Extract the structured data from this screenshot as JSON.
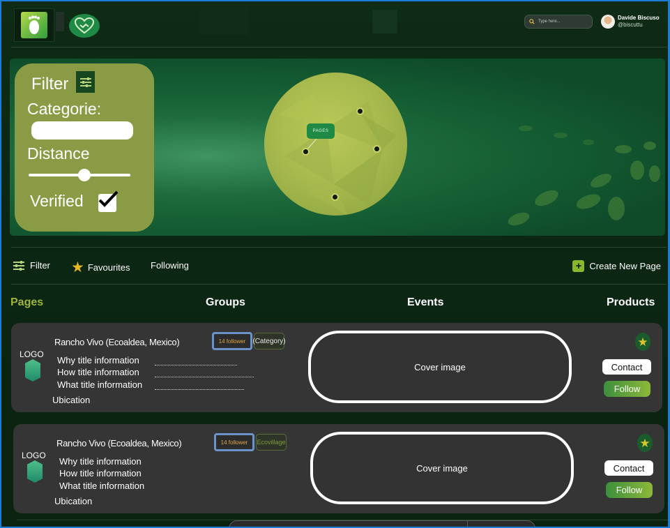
{
  "header": {
    "search_placeholder": "Type here...",
    "user_name": "Davide Biscuso",
    "user_handle": "@biscuttu"
  },
  "filter_panel": {
    "title": "Filter",
    "category_label": "Categorie:",
    "category_value": "",
    "distance_label": "Distance",
    "distance_level": 0.55,
    "verified_label": "Verified",
    "verified_checked": true,
    "verified_mark": "✔"
  },
  "map": {
    "chip_label": "PAGES"
  },
  "toolbar": {
    "filter_label": "Filter",
    "favourites_label": "Favourites",
    "following_label": "Following",
    "create_label": "Create New Page",
    "create_symbol": "+"
  },
  "categories": [
    {
      "label": "Pages",
      "active": true
    },
    {
      "label": "Groups",
      "active": false
    },
    {
      "label": "Events",
      "active": false
    },
    {
      "label": "Products",
      "active": false
    }
  ],
  "cards": [
    {
      "logo_text": "LOGO",
      "title": "Rancho Vivo (Ecoaldea, Mexico)",
      "followers": "14 follower",
      "category": "(Category)",
      "lines": [
        "Why title information",
        "How title information",
        "What title information"
      ],
      "location": "Ubication",
      "cover": "Cover image",
      "star": "★",
      "contact": "Contact",
      "follow": "Follow"
    },
    {
      "logo_text": "LOGO",
      "title": "Rancho Vivo (Ecoaldea, Mexico)",
      "followers": "14 follower",
      "category": "Ecovillage",
      "lines": [
        "Why title information",
        "How title information",
        "What title information"
      ],
      "location": "Ubication",
      "cover": "Cover image",
      "star": "★",
      "contact": "Contact",
      "follow": "Follow"
    }
  ],
  "colors": {
    "background": "#0c2313",
    "accent_green": "#1f8a46",
    "filter_card": "#8a9b45",
    "active_tab": "#9fb53a",
    "card_bg": "#353535",
    "follower_border": "#6c93c8"
  }
}
